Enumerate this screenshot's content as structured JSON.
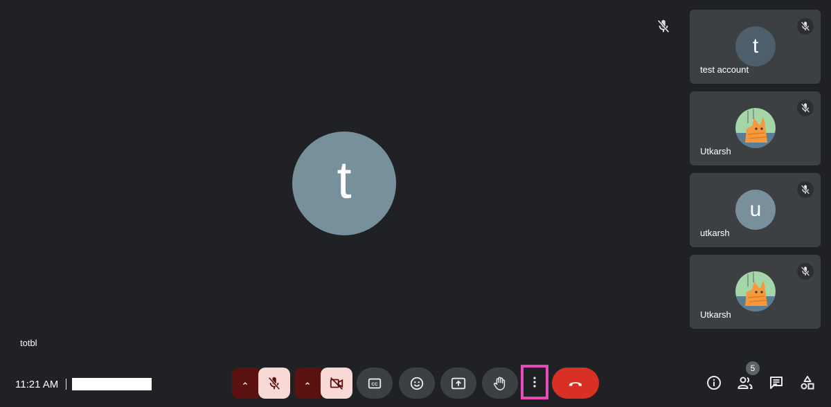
{
  "main": {
    "avatar_letter": "t",
    "name": "totbl"
  },
  "participants": [
    {
      "name": "test account",
      "avatar_letter": "t",
      "avatar_color": "#4d5f6b",
      "avatar_type": "letter"
    },
    {
      "name": "Utkarsh",
      "avatar_letter": "",
      "avatar_color": "#7cb342",
      "avatar_type": "image"
    },
    {
      "name": "utkarsh",
      "avatar_letter": "u",
      "avatar_color": "#78909c",
      "avatar_type": "letter"
    },
    {
      "name": "Utkarsh",
      "avatar_letter": "",
      "avatar_color": "#7cb342",
      "avatar_type": "image"
    }
  ],
  "footer": {
    "time": "11:21 AM",
    "people_count": "5"
  },
  "colors": {
    "background": "#202124",
    "tile": "#3c4043",
    "danger": "#d93025",
    "muted_dark": "#5c1111",
    "muted_light": "#f9d9d6",
    "highlight": "#e94cb8"
  },
  "icons": {
    "mic_off": "mic-off-icon",
    "camera_off": "videocam-off-icon",
    "captions": "closed-caption-icon",
    "emoji": "emoji-icon",
    "present": "present-screen-icon",
    "raise_hand": "raise-hand-icon",
    "more": "more-vert-icon",
    "end_call": "call-end-icon",
    "info": "info-icon",
    "people": "people-icon",
    "chat": "chat-icon",
    "activities": "activities-icon"
  }
}
